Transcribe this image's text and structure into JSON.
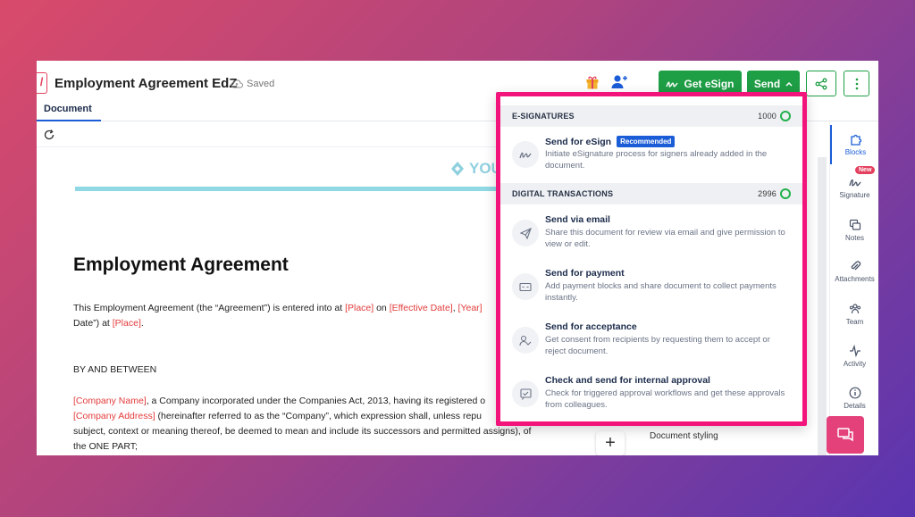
{
  "header": {
    "doc_title": "Employment Agreement EdZ",
    "saved_status": "Saved",
    "get_esign_label": "Get eSign",
    "send_label": "Send"
  },
  "tabs": {
    "document": "Document"
  },
  "document": {
    "brand_text": "YOU",
    "heading": "Employment Agreement",
    "p1_a": "This Employment Agreement (the “Agreement”) is entered into at ",
    "p1_place": "[Place]",
    "p1_b": " on ",
    "p1_date": "[Effective Date]",
    "p1_c": ", ",
    "p1_year": "[Year]",
    "p1_line2_a": "Date”) at ",
    "p1_line2_place": "[Place]",
    "p1_line2_b": ".",
    "p2": "BY AND BETWEEN",
    "p3_company": "[Company Name]",
    "p3_a": ", a Company incorporated under the Companies Act, 2013, having its registered o",
    "p3_address": "[Company Address]",
    "p3_b": " (hereinafter referred to as the “Company”, which expression shall, unless repu",
    "p3_c": "subject, context or meaning thereof, be deemed to mean and include its successors and permitted assigns), of",
    "p3_d": "the ONE PART;"
  },
  "side_panel": {
    "document_styling": "Document styling"
  },
  "rail": {
    "items": [
      {
        "label": "Blocks"
      },
      {
        "label": "Signature",
        "badge": "New"
      },
      {
        "label": "Notes"
      },
      {
        "label": "Attachments"
      },
      {
        "label": "Team"
      },
      {
        "label": "Activity"
      },
      {
        "label": "Details"
      }
    ]
  },
  "dropdown": {
    "esign_section": {
      "title": "E-SIGNATURES",
      "credits": "1000"
    },
    "digital_section": {
      "title": "DIGITAL TRANSACTIONS",
      "credits": "2996"
    },
    "items": [
      {
        "title": "Send for eSign",
        "badge": "Recommended",
        "desc": "Initiate eSignature process for signers already added in the document.",
        "icon": "signature-icon"
      },
      {
        "title": "Send via email",
        "desc": "Share this document for review via email and give permission to view or edit.",
        "icon": "paper-plane-icon"
      },
      {
        "title": "Send for payment",
        "desc": "Add payment blocks and share document to collect payments instantly.",
        "icon": "payment-icon"
      },
      {
        "title": "Send for acceptance",
        "desc": "Get consent from recipients by requesting them to accept or reject document.",
        "icon": "user-check-icon"
      },
      {
        "title": "Check and send for internal approval",
        "desc": "Check for triggered approval workflows and get these approvals from colleagues.",
        "icon": "approval-icon"
      }
    ]
  },
  "colors": {
    "accent_green": "#1e9e45",
    "highlight_pink": "#f2147a",
    "blue": "#1b5dd6",
    "placeholder_red": "#e33b3b"
  }
}
